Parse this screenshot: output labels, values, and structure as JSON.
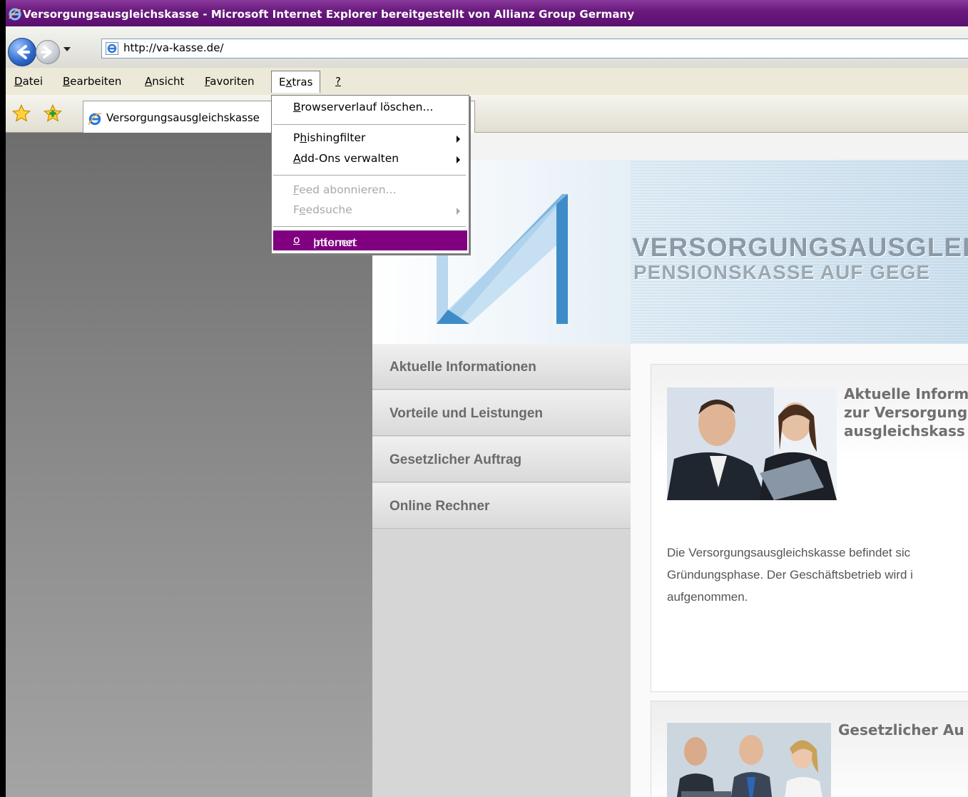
{
  "window": {
    "title": "Versorgungsausgleichskasse - Microsoft Internet Explorer bereitgestellt von Allianz Group Germany"
  },
  "address": {
    "url": "http://va-kasse.de/"
  },
  "menubar": {
    "items": [
      {
        "label": "Datei",
        "accel": "D",
        "rest": "atei"
      },
      {
        "label": "Bearbeiten",
        "accel": "B",
        "rest": "earbeiten"
      },
      {
        "label": "Ansicht",
        "accel": "A",
        "rest": "nsicht"
      },
      {
        "label": "Favoriten",
        "accel": "F",
        "rest": "avoriten"
      },
      {
        "label": "Extras",
        "pre": "E",
        "accel": "x",
        "rest": "tras"
      },
      {
        "label": "?",
        "accel": "?",
        "rest": ""
      }
    ]
  },
  "tab": {
    "title": "Versorgungsausgleichskasse"
  },
  "extras_menu": {
    "items": [
      {
        "pre": "",
        "accel": "B",
        "rest": "rowserverlauf löschen...",
        "disabled": false
      },
      {
        "pre": "P",
        "accel": "h",
        "rest": "ishingfilter",
        "disabled": false,
        "submenu": true
      },
      {
        "pre": "",
        "accel": "A",
        "rest": "dd-Ons verwalten",
        "disabled": false,
        "submenu": true
      },
      {
        "pre": "",
        "accel": "F",
        "rest": "eed abonnieren...",
        "disabled": true
      },
      {
        "pre": "F",
        "accel": "e",
        "rest": "edsuche",
        "disabled": true,
        "submenu": true
      },
      {
        "pre": "Internet",
        "accel": "o",
        "rest": "ptionen",
        "disabled": false,
        "highlighted": true
      }
    ]
  },
  "site": {
    "title": "VERSORGUNGSAUSGLEIC",
    "subtitle": "PENSIONSKASSE AUF GEGE",
    "nav": [
      "Aktuelle Informationen",
      "Vorteile und Leistungen",
      "Gesetzlicher Auftrag",
      "Online Rechner"
    ],
    "card1": {
      "heading": "Aktuelle Inform\nzur Versorgung\nausgleichskass",
      "text": "Die Versorgungsausgleichskasse befindet sic\nGründungsphase. Der Geschäftsbetrieb wird i\naufgenommen."
    },
    "card2": {
      "heading": "Gesetzlicher Au"
    }
  },
  "colors": {
    "titlebar": "#6a1b7e",
    "menu_highlight": "#800080",
    "nav_text": "#6a6a6a",
    "logo_blue": "#3d8cc8"
  }
}
